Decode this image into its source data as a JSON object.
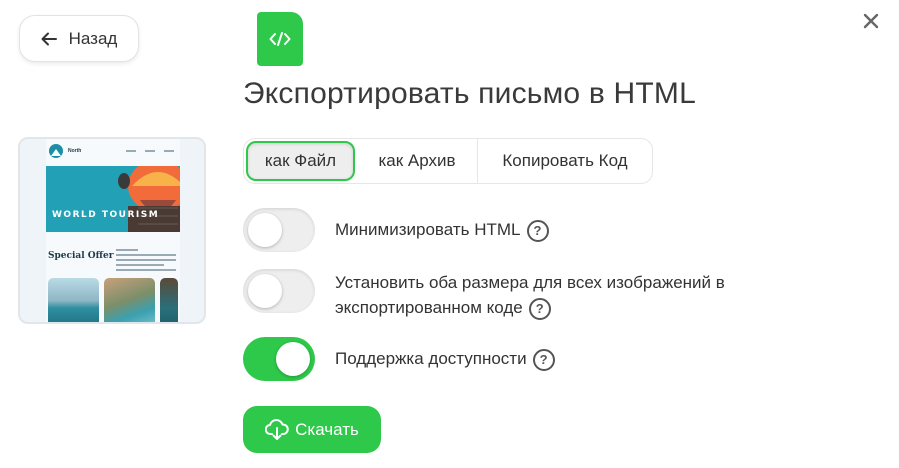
{
  "back_button": {
    "label": "Назад",
    "icon": "arrow-left-icon"
  },
  "close_icon": "close-icon",
  "badge_icon": "code-file-icon",
  "title": "Экспортировать письмо в HTML",
  "preview": {
    "brand": "North",
    "hero_text": "WORLD TOURISM",
    "offer_title": "Special Offer"
  },
  "tabs": [
    {
      "label": "как Файл",
      "active": true
    },
    {
      "label": "как Архив",
      "active": false
    },
    {
      "label": "Копировать Код",
      "active": false
    }
  ],
  "options": [
    {
      "label": "Минимизировать HTML",
      "enabled": false
    },
    {
      "label_line1": "Установить оба размера для всех изображений в",
      "label_line2": "экспортированном коде",
      "enabled": false
    },
    {
      "label": "Поддержка доступности",
      "enabled": true
    }
  ],
  "help_glyph": "?",
  "download_button": {
    "label": "Скачать",
    "icon": "cloud-download-icon"
  },
  "colors": {
    "accent": "#2ec84a",
    "toggle_off": "#eeeeee",
    "text": "#333333"
  }
}
